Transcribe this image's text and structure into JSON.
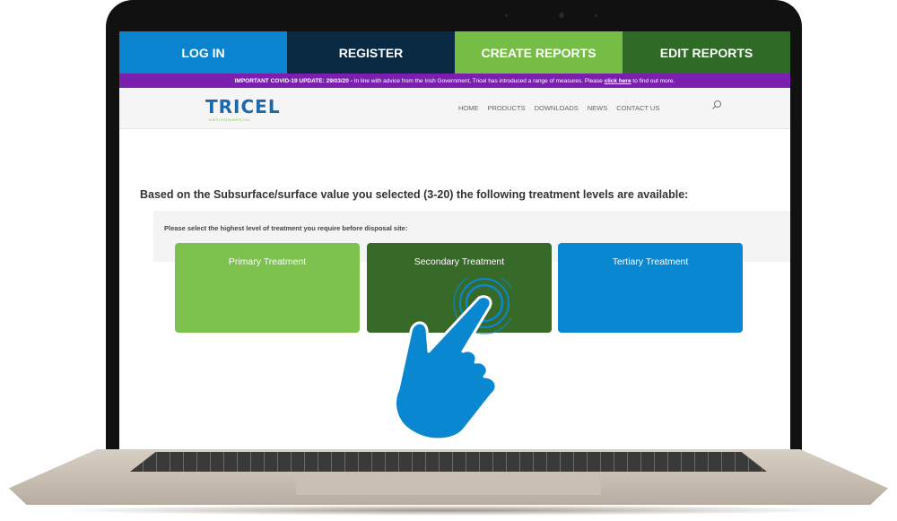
{
  "nav": {
    "login": "LOG IN",
    "register": "REGISTER",
    "create_reports": "CREATE REPORTS",
    "edit_reports": "EDIT REPORTS"
  },
  "covid_banner": {
    "title": "IMPORTANT COVID-19 UPDATE: 29/03/20 -",
    "text": " In line with advice from the Irish Government, Tricel has introduced a range of measures. Please ",
    "link": "click here",
    "tail": " to find out more."
  },
  "header": {
    "logo": "TRICEL",
    "logo_sub": "ENVIRONMENTAL",
    "menu": [
      "HOME",
      "PRODUCTS",
      "DOWNLOADS",
      "NEWS",
      "CONTACT US"
    ]
  },
  "main": {
    "question": "Based on the Subsurface/surface value you selected (3-20) the following treatment levels are available:",
    "instruction": "Please select the highest level of treatment you require before disposal site:",
    "options": [
      "Primary Treatment",
      "Secondary Treatment",
      "Tertiary Treatment"
    ]
  },
  "colors": {
    "login": "#0b84d0",
    "register": "#0a2a44",
    "create": "#76bd45",
    "edit": "#2f6a26",
    "covid": "#7a1fae",
    "hand": "#0a87d1"
  }
}
